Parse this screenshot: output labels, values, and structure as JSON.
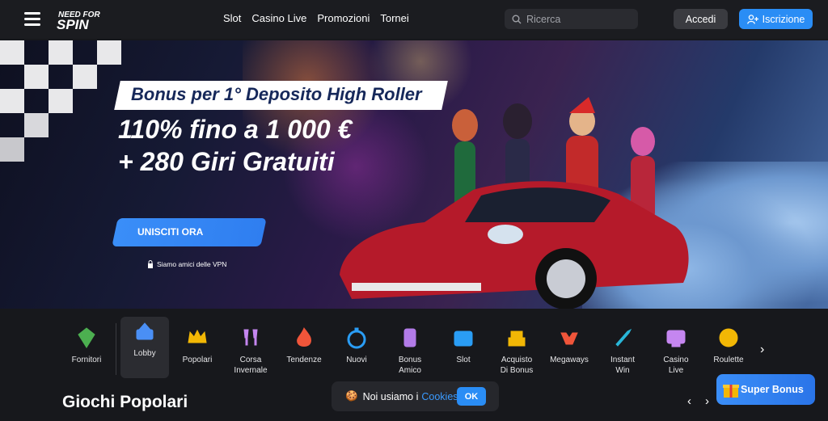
{
  "header": {
    "nav": [
      "Slot",
      "Casino Live",
      "Promozioni",
      "Tornei"
    ],
    "search_placeholder": "Ricerca",
    "login_label": "Accedi",
    "register_label": "Iscrizione"
  },
  "banner": {
    "tag": "Bonus per 1° Deposito High Roller",
    "offer_line1": "110% fino a 1 000 €",
    "offer_line2": "+ 280 Giri Gratuiti",
    "cta_label": "UNISCITI ORA",
    "vpn_note": "Siamo amici delle VPN"
  },
  "categories": [
    {
      "label": "Fornitori",
      "icon": "diamond-icon",
      "color": "#4caf50"
    },
    {
      "label": "Lobby",
      "icon": "lobby-icon",
      "color": "#4a8ff5"
    },
    {
      "label": "Popolari",
      "icon": "crown-icon",
      "color": "#f2b705"
    },
    {
      "label": "Corsa\nInvernale",
      "icon": "glasses-icon",
      "color": "#c586f0"
    },
    {
      "label": "Tendenze",
      "icon": "fire-icon",
      "color": "#f0553a"
    },
    {
      "label": "Nuovi",
      "icon": "stopwatch-icon",
      "color": "#2a9df5"
    },
    {
      "label": "Bonus\nAmico",
      "icon": "dollar-icon",
      "color": "#b27be8"
    },
    {
      "label": "Slot",
      "icon": "slot-icon",
      "color": "#2a9df5"
    },
    {
      "label": "Acquisto\nDi Bonus",
      "icon": "cake-icon",
      "color": "#f2b705"
    },
    {
      "label": "Megaways",
      "icon": "megaways-icon",
      "color": "#f0553a"
    },
    {
      "label": "Instant\nWin",
      "icon": "rocket-icon",
      "color": "#29b6d8"
    },
    {
      "label": "Casino\nLive",
      "icon": "live-icon",
      "color": "#c586f0"
    },
    {
      "label": "Roulette",
      "icon": "roulette-icon",
      "color": "#f2b705"
    }
  ],
  "section_title": "Giochi Popolari",
  "cookie": {
    "text": "Noi usiamo i",
    "link": "Cookies",
    "ok": "OK"
  },
  "super_bonus": "Super Bonus",
  "colors": {
    "accent": "#2a8df5",
    "bg": "#17181c"
  }
}
